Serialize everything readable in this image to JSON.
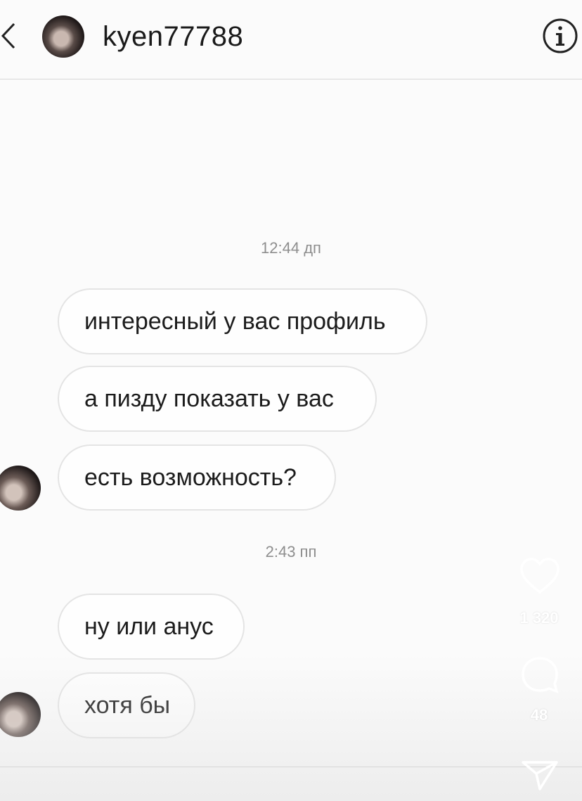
{
  "header": {
    "username": "kyen77788",
    "icons": {
      "back": "chevron-left-icon",
      "info": "info-icon"
    }
  },
  "conversation": {
    "timestamps": [
      "12:44 дп",
      "2:43 пп"
    ],
    "messages": [
      "интересный у вас профиль",
      "а пизду показать у вас",
      "есть возможность?",
      "ну или анус",
      "хотя бы"
    ]
  },
  "story_overlay": {
    "likes_count": "1 320",
    "comments_count": "48",
    "icons": {
      "like": "heart-icon",
      "comment": "comment-icon",
      "share": "send-icon"
    }
  },
  "colors": {
    "background": "#fbfbfb",
    "bubble_border": "#e4e4e4",
    "timestamp": "#8e8e8e",
    "text": "#1a1a1a"
  }
}
